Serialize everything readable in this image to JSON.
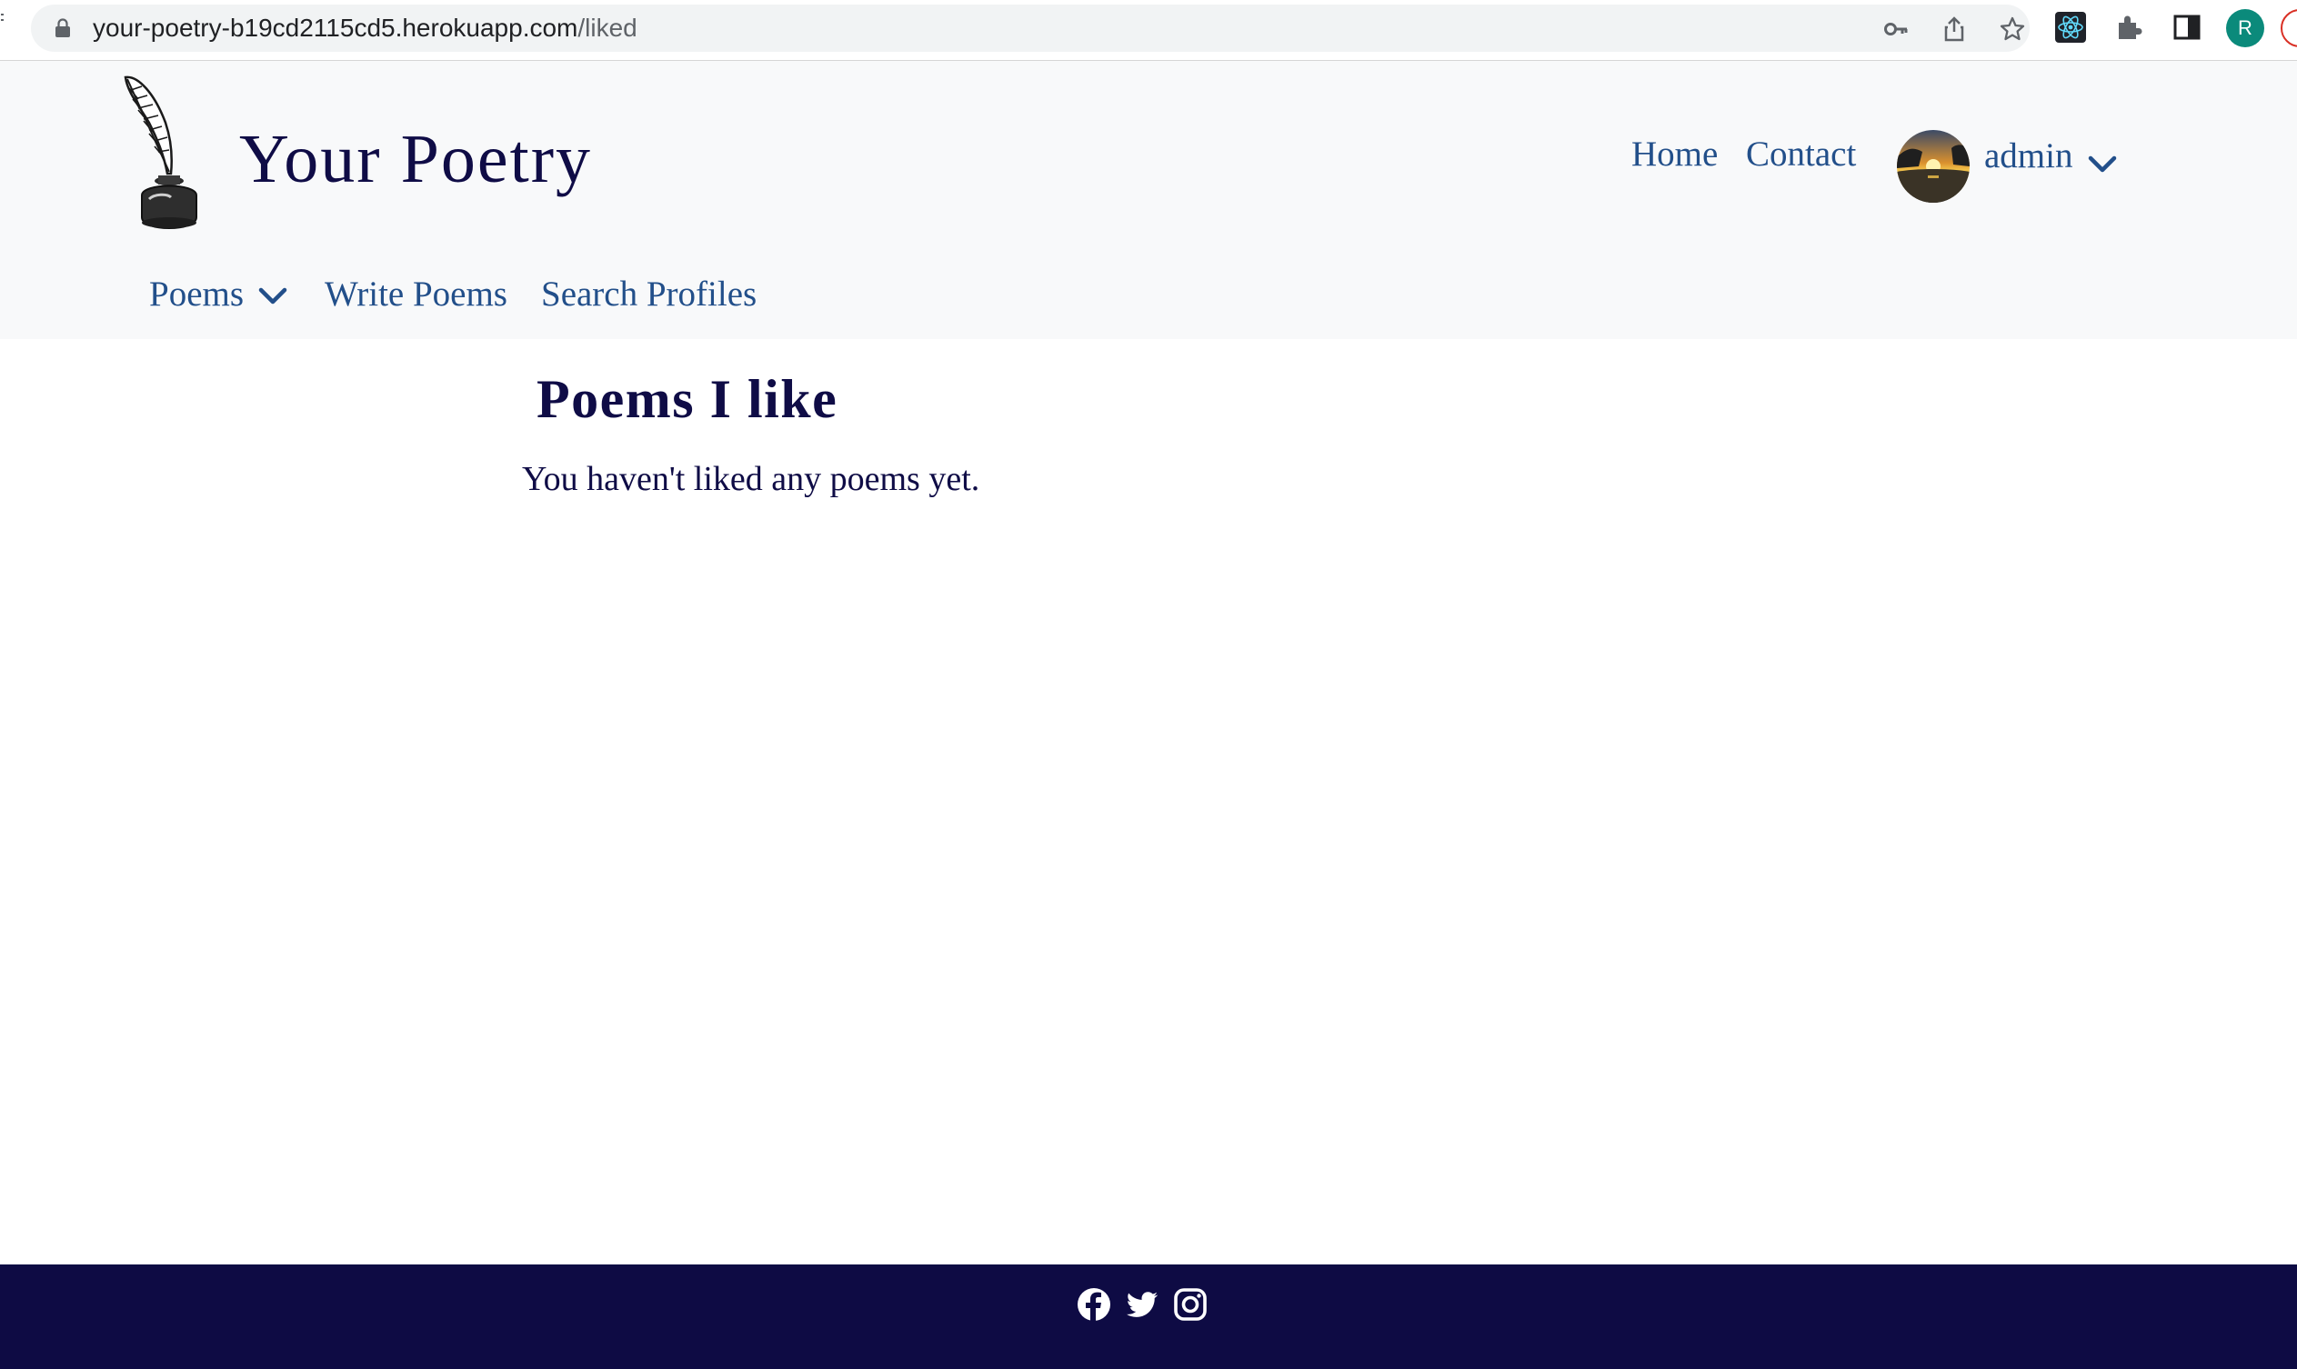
{
  "browser": {
    "url_host": "your-poetry-b19cd2115cd5.herokuapp.com",
    "url_path": "/liked",
    "profile_initial": "R",
    "icons": [
      "lock-icon",
      "key-icon",
      "share-icon",
      "star-icon",
      "react-devtools-icon",
      "extensions-icon",
      "side-panel-icon",
      "profile-icon"
    ]
  },
  "header": {
    "brand": "Your Poetry",
    "nav": {
      "home": "Home",
      "contact": "Contact",
      "user": "admin"
    },
    "subnav": {
      "poems": "Poems",
      "write": "Write Poems",
      "search": "Search Profiles"
    }
  },
  "main": {
    "title": "Poems I like",
    "empty_message": "You haven't liked any poems yet."
  },
  "footer": {
    "icons": [
      "facebook-icon",
      "twitter-icon",
      "instagram-icon"
    ]
  },
  "colors": {
    "brand_navy": "#0f0c46",
    "link_blue": "#224f8a",
    "header_bg": "#f8f9fa",
    "footer_bg": "#0e0b44",
    "profile_teal": "#0b8a7b"
  }
}
